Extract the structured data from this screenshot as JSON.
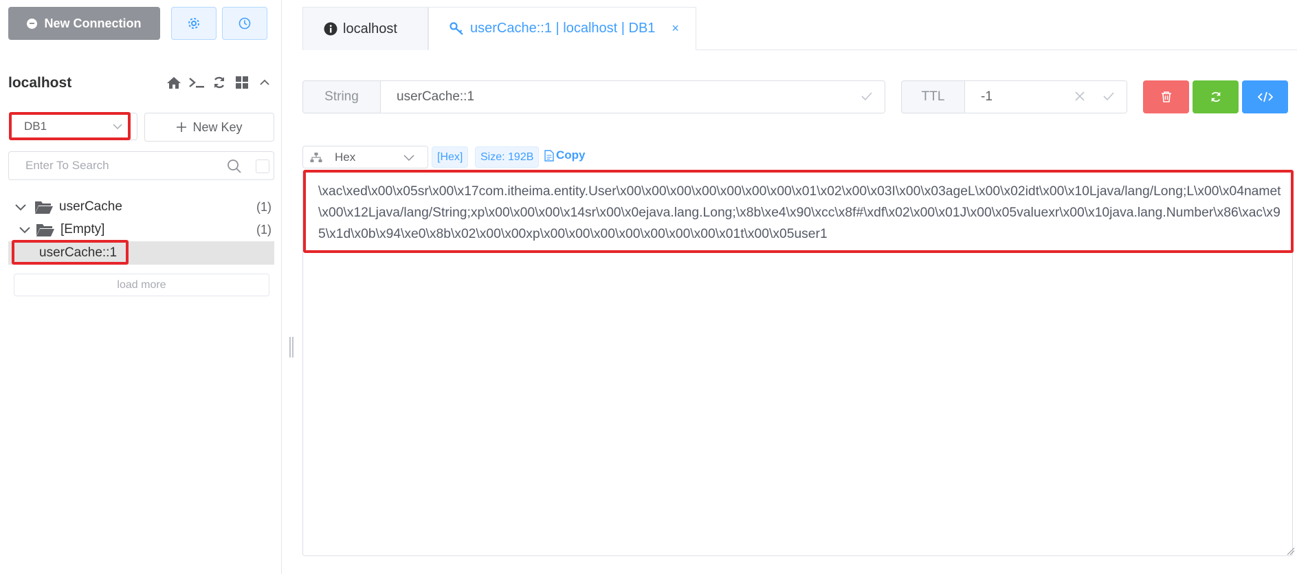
{
  "toolbar": {
    "new_connection_label": "New Connection",
    "settings_icon": "gear-icon",
    "history_icon": "clock-icon"
  },
  "connection": {
    "name": "localhost",
    "tool_icons": [
      "home-icon",
      "terminal-icon",
      "refresh-icon",
      "grid-icon",
      "chevron-up-icon"
    ]
  },
  "db_select": {
    "value": "DB1"
  },
  "new_key_label": "New Key",
  "search": {
    "placeholder": "Enter To Search"
  },
  "tree": {
    "folder_name": "userCache",
    "folder_count": "(1)",
    "subfolder_name": "[Empty]",
    "subfolder_count": "(1)",
    "selected_key": "userCache::1",
    "load_more_label": "load more"
  },
  "tabs": {
    "server_tab": "localhost",
    "key_tab": "userCache::1 | localhost | DB1",
    "close_symbol": "×"
  },
  "key_bar": {
    "type_label": "String",
    "key_value": "userCache::1",
    "ttl_label": "TTL",
    "ttl_value": "-1"
  },
  "actions": {
    "delete_color": "#f56c6c",
    "refresh_color": "#67c23a",
    "code_color": "#409eff"
  },
  "value_view": {
    "format": "Hex",
    "format_tag": "[Hex]",
    "size_tag": "Size: 192B",
    "copy_label": "Copy",
    "content": "\\xac\\xed\\x00\\x05sr\\x00\\x17com.itheima.entity.User\\x00\\x00\\x00\\x00\\x00\\x00\\x00\\x01\\x02\\x00\\x03I\\x00\\x03ageL\\x00\\x02idt\\x00\\x10Ljava/lang/Long;L\\x00\\x04namet\\x00\\x12Ljava/lang/String;xp\\x00\\x00\\x00\\x14sr\\x00\\x0ejava.lang.Long;\\x8b\\xe4\\x90\\xcc\\x8f#\\xdf\\x02\\x00\\x01J\\x00\\x05valuexr\\x00\\x10java.lang.Number\\x86\\xac\\x95\\x1d\\x0b\\x94\\xe0\\x8b\\x02\\x00\\x00xp\\x00\\x00\\x00\\x00\\x00\\x00\\x00\\x01t\\x00\\x05user1"
  }
}
